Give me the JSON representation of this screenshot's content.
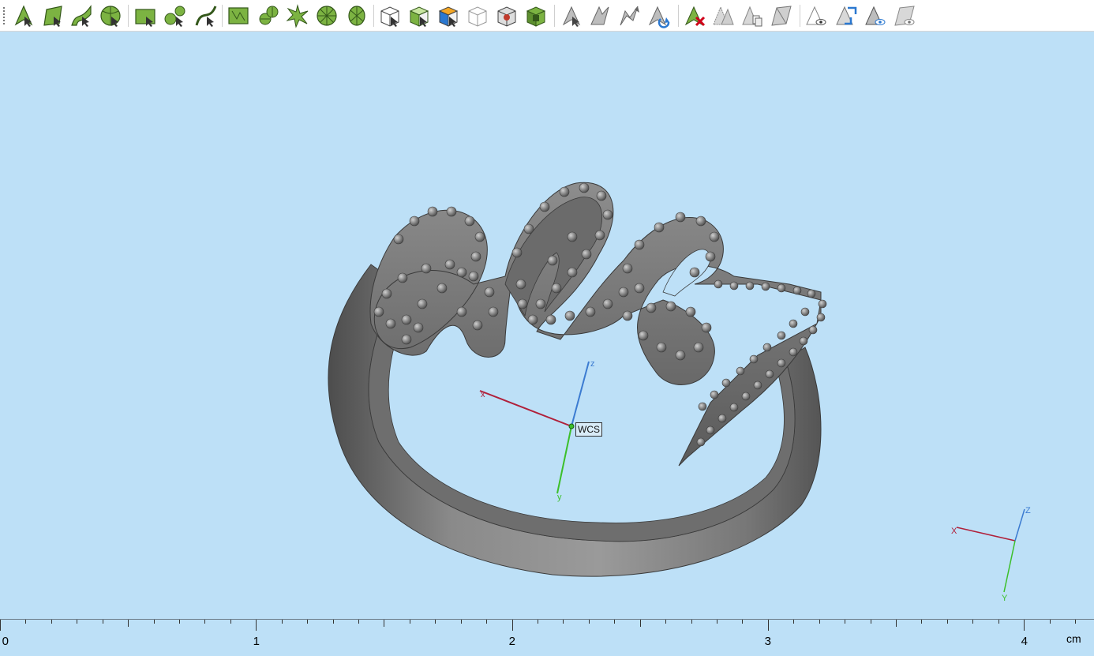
{
  "toolbar": {
    "buttons": [
      {
        "name": "select-arrow-icon"
      },
      {
        "name": "select-surface-icon"
      },
      {
        "name": "select-curve-icon"
      },
      {
        "name": "select-solid-icon"
      },
      {
        "name": "select-face-icon"
      },
      {
        "name": "select-edge-icon"
      },
      {
        "name": "select-curve-segment-icon"
      },
      {
        "name": "face-grid-icon"
      },
      {
        "name": "face-cluster-icon"
      },
      {
        "name": "face-star-icon"
      },
      {
        "name": "face-radial-icon"
      },
      {
        "name": "face-split-icon"
      },
      {
        "name": "box-white-icon"
      },
      {
        "name": "box-solid-icon"
      },
      {
        "name": "box-color-icon"
      },
      {
        "name": "box-wireframe-icon"
      },
      {
        "name": "box-hidden-icon"
      },
      {
        "name": "box-green-icon"
      },
      {
        "name": "pointer-grey-icon"
      },
      {
        "name": "pointer-double-icon"
      },
      {
        "name": "pointer-move-icon"
      },
      {
        "name": "pointer-rotate-icon"
      },
      {
        "name": "delete-selection-icon"
      },
      {
        "name": "hide-object-icon"
      },
      {
        "name": "copy-object-icon"
      },
      {
        "name": "show-object-icon"
      },
      {
        "name": "eye-object-icon"
      },
      {
        "name": "swap-visibility-icon"
      },
      {
        "name": "show-eye-icon"
      },
      {
        "name": "hide-all-icon"
      }
    ]
  },
  "viewport": {
    "model": "ring-3d-model",
    "wcs_label": "WCS",
    "wcs_axes": {
      "x": "x",
      "y": "y",
      "z": "z"
    },
    "corner_axes": {
      "x": "X",
      "y": "Y",
      "z": "Z"
    },
    "colors": {
      "background": "#bde0f7",
      "model": "#7a7a7a",
      "x_axis": "#b0203a",
      "y_axis": "#3cbf2a",
      "z_axis": "#3b7bd1"
    }
  },
  "ruler": {
    "labels": [
      "0",
      "1",
      "2",
      "3",
      "4"
    ],
    "unit": "cm"
  }
}
